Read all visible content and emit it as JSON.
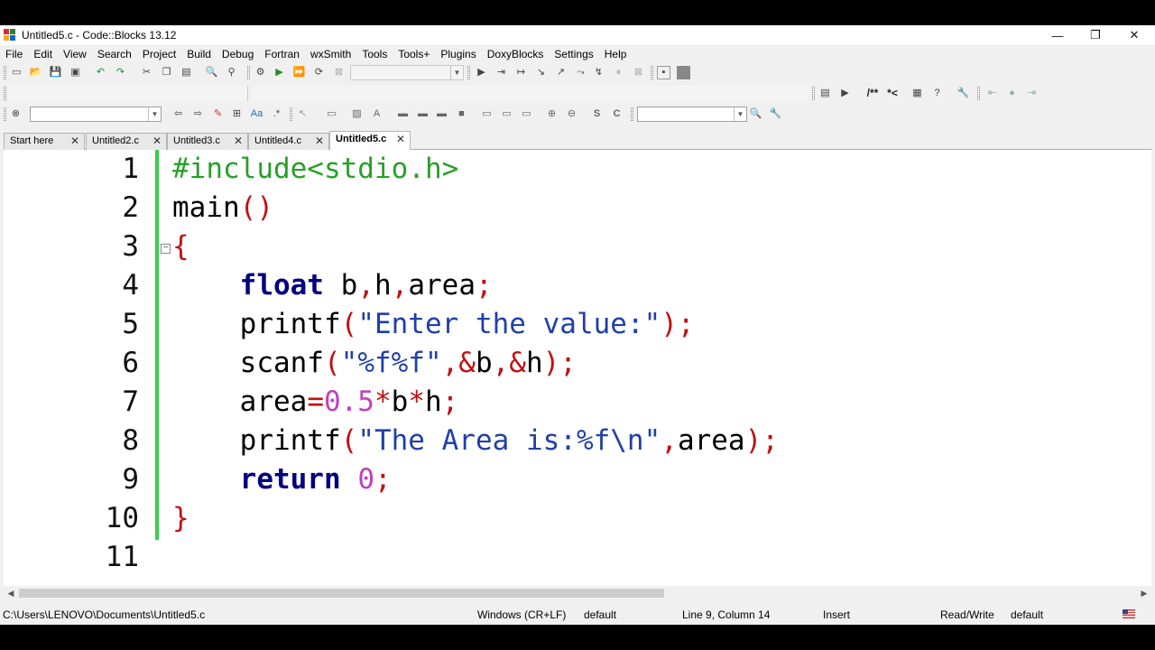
{
  "window": {
    "title": "Untitled5.c - Code::Blocks 13.12",
    "minimize": "—",
    "restore": "❐",
    "close": "✕"
  },
  "menu": [
    "File",
    "Edit",
    "View",
    "Search",
    "Project",
    "Build",
    "Debug",
    "Fortran",
    "wxSmith",
    "Tools",
    "Tools+",
    "Plugins",
    "DoxyBlocks",
    "Settings",
    "Help"
  ],
  "toolbar": {
    "doxy_block": "/**",
    "doxy_line": "*<"
  },
  "tabs": [
    {
      "label": "Start here",
      "active": false
    },
    {
      "label": "Untitled2.c",
      "active": false
    },
    {
      "label": "Untitled3.c",
      "active": false
    },
    {
      "label": "Untitled4.c",
      "active": false
    },
    {
      "label": "Untitled5.c",
      "active": true
    }
  ],
  "editor": {
    "line_numbers": [
      "1",
      "2",
      "3",
      "4",
      "5",
      "6",
      "7",
      "8",
      "9",
      "10",
      "11"
    ],
    "lines": [
      [
        {
          "t": "#include<stdio.h>",
          "c": "pp"
        }
      ],
      [
        {
          "t": "main",
          "c": "idf"
        },
        {
          "t": "()",
          "c": "op"
        }
      ],
      [
        {
          "t": "{",
          "c": "op"
        }
      ],
      [
        {
          "t": "    ",
          "c": "idf"
        },
        {
          "t": "float",
          "c": "kw"
        },
        {
          "t": " b",
          "c": "idf"
        },
        {
          "t": ",",
          "c": "op"
        },
        {
          "t": "h",
          "c": "idf"
        },
        {
          "t": ",",
          "c": "op"
        },
        {
          "t": "area",
          "c": "idf"
        },
        {
          "t": ";",
          "c": "op"
        }
      ],
      [
        {
          "t": "    printf",
          "c": "idf"
        },
        {
          "t": "(",
          "c": "op"
        },
        {
          "t": "\"Enter the value:\"",
          "c": "str"
        },
        {
          "t": ");",
          "c": "op"
        }
      ],
      [
        {
          "t": "    scanf",
          "c": "idf"
        },
        {
          "t": "(",
          "c": "op"
        },
        {
          "t": "\"%f%f\"",
          "c": "str"
        },
        {
          "t": ",&",
          "c": "op"
        },
        {
          "t": "b",
          "c": "idf"
        },
        {
          "t": ",&",
          "c": "op"
        },
        {
          "t": "h",
          "c": "idf"
        },
        {
          "t": ");",
          "c": "op"
        }
      ],
      [
        {
          "t": "    area",
          "c": "idf"
        },
        {
          "t": "=",
          "c": "op"
        },
        {
          "t": "0.5",
          "c": "num"
        },
        {
          "t": "*",
          "c": "op"
        },
        {
          "t": "b",
          "c": "idf"
        },
        {
          "t": "*",
          "c": "op"
        },
        {
          "t": "h",
          "c": "idf"
        },
        {
          "t": ";",
          "c": "op"
        }
      ],
      [
        {
          "t": "    printf",
          "c": "idf"
        },
        {
          "t": "(",
          "c": "op"
        },
        {
          "t": "\"The Area is:%f\\n\"",
          "c": "str"
        },
        {
          "t": ",",
          "c": "op"
        },
        {
          "t": "area",
          "c": "idf"
        },
        {
          "t": ");",
          "c": "op"
        }
      ],
      [
        {
          "t": "    ",
          "c": "idf"
        },
        {
          "t": "return",
          "c": "kw"
        },
        {
          "t": " ",
          "c": "idf"
        },
        {
          "t": "0",
          "c": "num"
        },
        {
          "t": ";",
          "c": "op"
        }
      ],
      [
        {
          "t": "}",
          "c": "op"
        }
      ],
      []
    ],
    "fold_marker": "−"
  },
  "status": {
    "path": "C:\\Users\\LENOVO\\Documents\\Untitled5.c",
    "eol": "Windows (CR+LF)",
    "encoding": "default",
    "position": "Line 9, Column 14",
    "mode": "Insert",
    "access": "Read/Write",
    "lang": "default"
  }
}
